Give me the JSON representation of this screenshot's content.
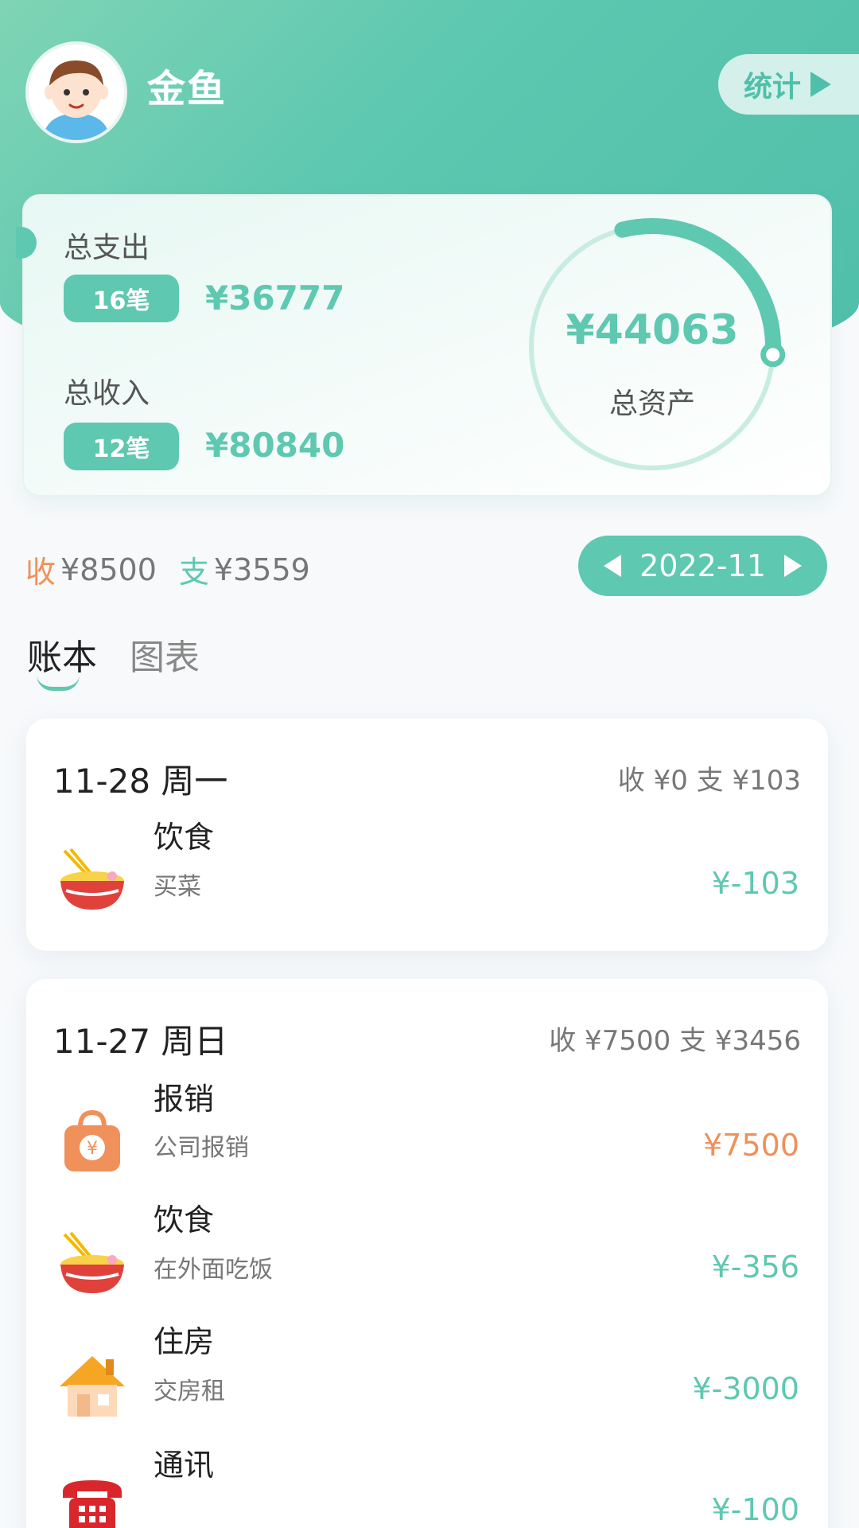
{
  "user": {
    "name": "金鱼"
  },
  "header": {
    "stats_label": "统计"
  },
  "summary": {
    "expense_label": "总支出",
    "expense_count": "16笔",
    "expense_amount": "¥36777",
    "income_label": "总收入",
    "income_count": "12笔",
    "income_amount": "¥80840",
    "asset_value": "¥44063",
    "asset_label": "总资产",
    "ring_fraction": 0.3,
    "accent_color": "#5ec8b0"
  },
  "month": {
    "income_prefix": "收",
    "income_value": "¥8500",
    "expense_prefix": "支",
    "expense_value": "¥3559",
    "current": "2022-11"
  },
  "tabs": [
    {
      "label": "账本",
      "active": true
    },
    {
      "label": "图表",
      "active": false
    }
  ],
  "days": [
    {
      "date": "11-28 周一",
      "summary": "收 ¥0   支 ¥103",
      "records": [
        {
          "icon": "noodle-bowl-icon",
          "category": "饮食",
          "note": "买菜",
          "amount": "¥-103",
          "type": "expense"
        }
      ]
    },
    {
      "date": "11-27 周日",
      "summary": "收 ¥7500   支 ¥3456",
      "records": [
        {
          "icon": "money-bag-icon",
          "category": "报销",
          "note": "公司报销",
          "amount": "¥7500",
          "type": "income"
        },
        {
          "icon": "noodle-bowl-icon",
          "category": "饮食",
          "note": "在外面吃饭",
          "amount": "¥-356",
          "type": "expense"
        },
        {
          "icon": "house-icon",
          "category": "住房",
          "note": "交房租",
          "amount": "¥-3000",
          "type": "expense"
        },
        {
          "icon": "telephone-icon",
          "category": "通讯",
          "note": "",
          "amount": "¥-100",
          "type": "expense"
        }
      ]
    }
  ],
  "colors": {
    "income": "#f0905a",
    "expense": "#5ec8b0"
  }
}
